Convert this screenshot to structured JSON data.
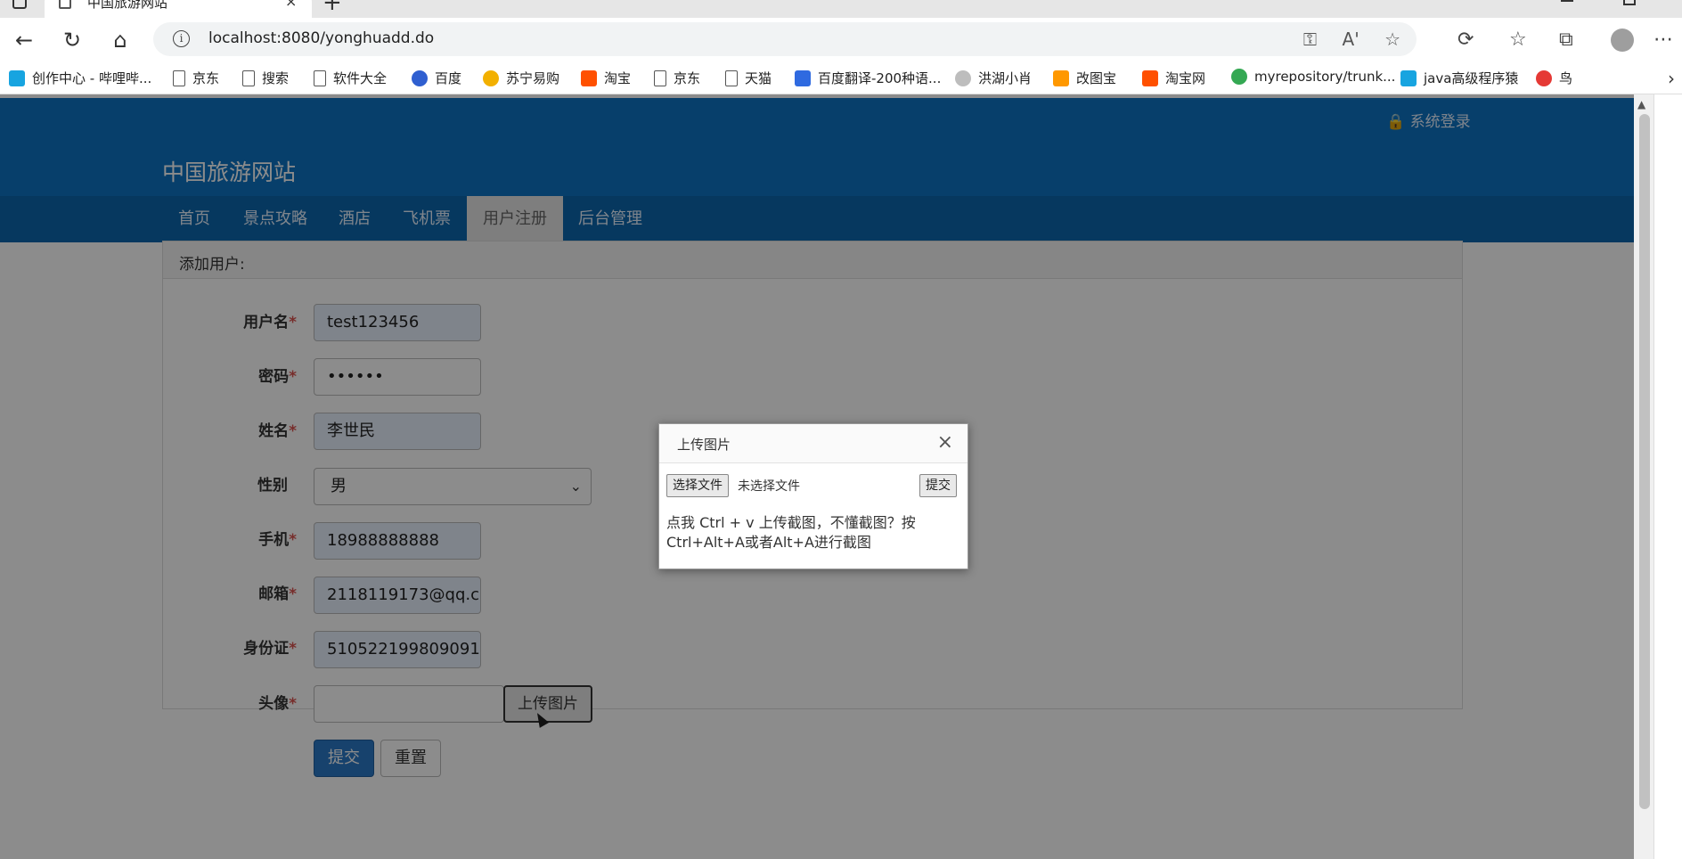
{
  "browser": {
    "tab_title": "中国旅游网站",
    "tab_close": "×",
    "new_tab": "+",
    "url": "localhost:8080/yonghuadd.do",
    "url_info": "i",
    "url_icons": [
      "⚿",
      "A'",
      "☆"
    ],
    "toolbar_icons": [
      "⟳",
      "☆",
      "⧉",
      "⋯"
    ],
    "nav_icons": {
      "back": "←",
      "reload": "↻",
      "home": "⌂"
    },
    "bookmarks": [
      {
        "label": "创作中心 - 哔哩哔...",
        "icon": "bilibili-icon",
        "color": "#17a4e0"
      },
      {
        "label": "京东",
        "icon": "doc-icon",
        "color": ""
      },
      {
        "label": "搜索",
        "icon": "doc-icon",
        "color": ""
      },
      {
        "label": "软件大全",
        "icon": "doc-icon",
        "color": ""
      },
      {
        "label": "百度",
        "icon": "baidu-icon",
        "color": "#2f5fd0"
      },
      {
        "label": "苏宁易购",
        "icon": "suning-icon",
        "color": "#f2b000"
      },
      {
        "label": "淘宝",
        "icon": "taobao-icon",
        "color": "#ff5000"
      },
      {
        "label": "京东",
        "icon": "doc-icon",
        "color": ""
      },
      {
        "label": "天猫",
        "icon": "doc-icon",
        "color": ""
      },
      {
        "label": "百度翻译-200种语...",
        "icon": "translate-icon",
        "color": "#2f6ae0"
      },
      {
        "label": "洪湖小肖",
        "icon": "bird-icon",
        "color": "#888888"
      },
      {
        "label": "改图宝",
        "icon": "gaitubao-icon",
        "color": "#ff9800"
      },
      {
        "label": "淘宝网",
        "icon": "taobao-icon",
        "color": "#ff5000"
      },
      {
        "label": "myrepository/trunk...",
        "icon": "chrome-icon",
        "color": "#34a853"
      },
      {
        "label": "java高级程序猿",
        "icon": "bilibili-icon",
        "color": "#17a4e0"
      },
      {
        "label": "鸟",
        "icon": "bird-icon",
        "color": "#e53935"
      }
    ],
    "bookmarks_more": "›"
  },
  "site": {
    "title": "中国旅游网站",
    "login": "🔒 系统登录",
    "nav": [
      {
        "label": "首页",
        "active": false
      },
      {
        "label": "景点攻略",
        "active": false
      },
      {
        "label": "酒店",
        "active": false
      },
      {
        "label": "飞机票",
        "active": false
      },
      {
        "label": "用户注册",
        "active": true
      },
      {
        "label": "后台管理",
        "active": false
      }
    ]
  },
  "form": {
    "panel_title": "添加用户:",
    "required_mark": "*",
    "fields": {
      "username": {
        "label": "用户名",
        "value": "test123456"
      },
      "password": {
        "label": "密码",
        "value": "••••••"
      },
      "name": {
        "label": "姓名",
        "value": "李世民"
      },
      "gender": {
        "label": "性别",
        "value": "男"
      },
      "phone": {
        "label": "手机",
        "value": "18988888888"
      },
      "email": {
        "label": "邮箱",
        "value": "2118119173@qq.c"
      },
      "idcard": {
        "label": "身份证",
        "value": "510522199809091"
      },
      "avatar": {
        "label": "头像",
        "value": ""
      }
    },
    "upload_button": "上传图片",
    "submit_button": "提交",
    "reset_button": "重置"
  },
  "modal": {
    "title": "上传图片",
    "close": "×",
    "choose_file": "选择文件",
    "no_file": "未选择文件",
    "submit": "提交",
    "hint": "点我 Ctrl + v 上传截图，不懂截图？按 Ctrl+Alt+A或者Alt+A进行截图"
  }
}
